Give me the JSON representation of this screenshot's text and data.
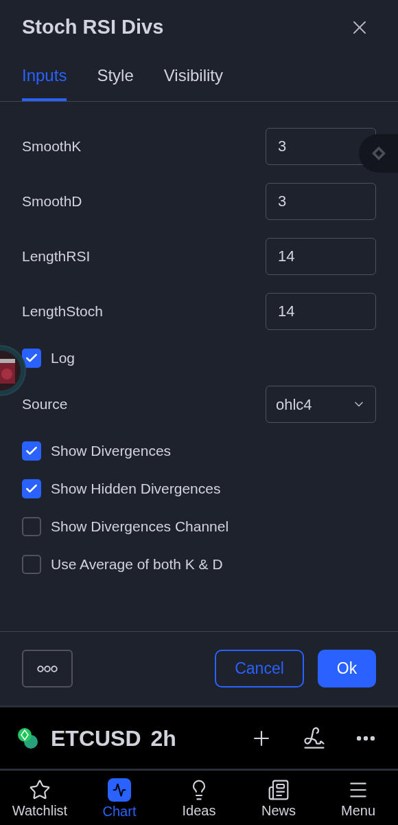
{
  "dialog": {
    "title": "Stoch RSI Divs"
  },
  "tabs": [
    {
      "label": "Inputs",
      "selected": true
    },
    {
      "label": "Style",
      "selected": false
    },
    {
      "label": "Visibility",
      "selected": false
    }
  ],
  "inputs": [
    {
      "kind": "number",
      "label": "SmoothK",
      "value": "3"
    },
    {
      "kind": "number",
      "label": "SmoothD",
      "value": "3"
    },
    {
      "kind": "number",
      "label": "LengthRSI",
      "value": "14"
    },
    {
      "kind": "number",
      "label": "LengthStoch",
      "value": "14"
    },
    {
      "kind": "checkbox",
      "label": "Log",
      "checked": true
    },
    {
      "kind": "select",
      "label": "Source",
      "value": "ohlc4"
    },
    {
      "kind": "checkbox",
      "label": "Show Divergences",
      "checked": true
    },
    {
      "kind": "checkbox",
      "label": "Show Hidden Divergences",
      "checked": true
    },
    {
      "kind": "checkbox",
      "label": "Show Divergences Channel",
      "checked": false
    },
    {
      "kind": "checkbox",
      "label": "Use Average of both K & D",
      "checked": false
    }
  ],
  "footer": {
    "cancel": "Cancel",
    "ok": "Ok"
  },
  "symbol_bar": {
    "symbol": "ETCUSD",
    "interval": "2h"
  },
  "nav": [
    {
      "kind": "watchlist",
      "label": "Watchlist",
      "selected": false
    },
    {
      "kind": "chart",
      "label": "Chart",
      "selected": true
    },
    {
      "kind": "ideas",
      "label": "Ideas",
      "selected": false
    },
    {
      "kind": "news",
      "label": "News",
      "selected": false
    },
    {
      "kind": "menu",
      "label": "Menu",
      "selected": false
    }
  ]
}
